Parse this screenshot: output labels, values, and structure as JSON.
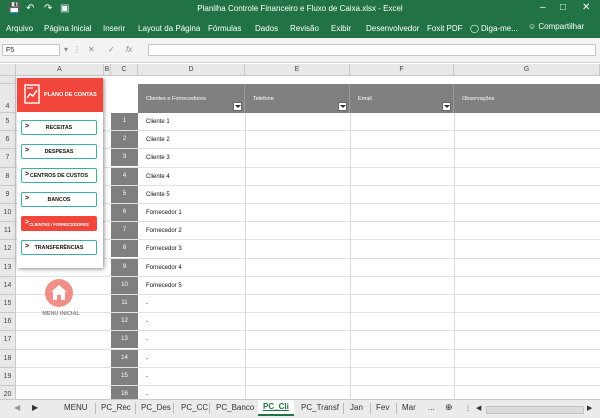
{
  "window": {
    "title": "Planilha Controle Financeiro e Fluxo de Caixa.xlsx - Excel",
    "quick_access": [
      "save-icon",
      "undo-icon",
      "redo-icon",
      "print-preview-icon"
    ]
  },
  "ribbon": {
    "tabs": [
      "Arquivo",
      "Página Inicial",
      "Inserir",
      "Layout da Página",
      "Fórmulas",
      "Dados",
      "Revisão",
      "Exibir",
      "Desenvolvedor",
      "Foxit PDF"
    ],
    "tell_me": "Diga-me...",
    "share": "Compartilhar"
  },
  "formula_bar": {
    "name_box": "F5",
    "fx": "fx"
  },
  "columns": [
    "A",
    "B",
    "C",
    "D",
    "E",
    "F",
    "G"
  ],
  "rows": [
    "4",
    "5",
    "6",
    "7",
    "8",
    "9",
    "10",
    "11",
    "12",
    "13",
    "14",
    "15",
    "16",
    "17",
    "18",
    "19",
    "20"
  ],
  "menu": {
    "title": "PLANO DE CONTAS",
    "buttons": [
      "RECEITAS",
      "DESPESAS",
      "CENTROS DE CUSTOS",
      "BANCOS",
      "CLIENTES / FORNECEDORES",
      "TRANSFERÊNCIAS"
    ],
    "active_index": 4,
    "arrow": ">",
    "home_label": "MENU INICIAL"
  },
  "table": {
    "headers": [
      "Clientes e Fornecedores",
      "Telefone",
      "Email",
      "Observações"
    ],
    "ids": [
      "1",
      "2",
      "3",
      "4",
      "5",
      "6",
      "7",
      "8",
      "9",
      "10",
      "11",
      "12",
      "13",
      "14",
      "15",
      "16"
    ],
    "names": [
      "Cliente 1",
      "Cliente 2",
      "Cliente 3",
      "Cliente 4",
      "Cliente 5",
      "Fornecedor 1",
      "Fornecedor 2",
      "Fornecedor 3",
      "Fornecedor 4",
      "Fornecedor 5",
      "-",
      "-",
      "-",
      "-",
      "-",
      "-"
    ]
  },
  "sheet_tabs": {
    "tabs": [
      "MENU",
      "PC_Rec",
      "PC_Des",
      "PC_CC",
      "PC_Banco",
      "PC_Cli",
      "PC_Transf",
      "Jan",
      "Fev",
      "Mar",
      "..."
    ],
    "active": "PC_Cli"
  },
  "colors": {
    "excel_green": "#217346",
    "accent_red": "#f0463c",
    "teal_border": "#3bb09e",
    "header_gray": "#808080"
  }
}
